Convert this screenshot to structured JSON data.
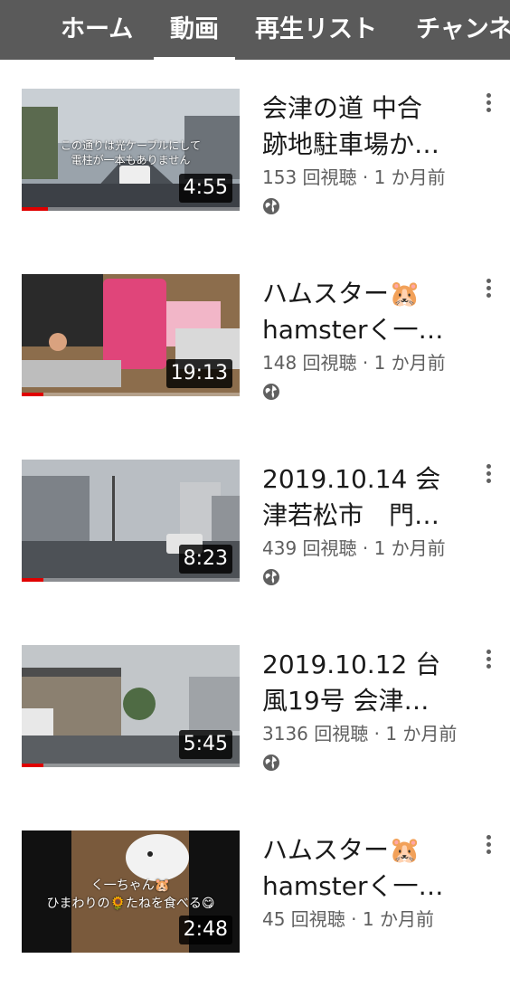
{
  "tabs": [
    {
      "label": "ホーム",
      "active": false
    },
    {
      "label": "動画",
      "active": true
    },
    {
      "label": "再生リスト",
      "active": false
    },
    {
      "label": "チャンネ",
      "active": false
    }
  ],
  "videos": [
    {
      "title": "会津の道 中合\n跡地駐車場か…",
      "meta": "153 回視聴 · 1 か月前",
      "duration": "4:55",
      "watched_fraction": 0.12,
      "thumb_caption_1": "この通りは光ケーブルにして",
      "thumb_caption_2": "電柱が一本もありません"
    },
    {
      "title": "ハムスター🐹\nhamsterく一…",
      "meta": "148 回視聴 · 1 か月前",
      "duration": "19:13",
      "watched_fraction": 0.1
    },
    {
      "title": "2019.10.14 会\n津若松市　門…",
      "meta": "439 回視聴 · 1 か月前",
      "duration": "8:23",
      "watched_fraction": 0.1
    },
    {
      "title": "2019.10.12 台\n風19号 会津…",
      "meta": "3136 回視聴 · 1 か月前",
      "duration": "5:45",
      "watched_fraction": 0.1
    },
    {
      "title": "ハムスター🐹\nhamsterく一…",
      "meta": "45 回視聴 · 1 か月前",
      "duration": "2:48",
      "watched_fraction": 0,
      "thumb_caption_1": "く一ちゃん🐹",
      "thumb_caption_2": "ひまわりの🌻たねを食べる😋"
    }
  ],
  "colors": {
    "tabbar": "#5a5a5a",
    "progress": "#e00000"
  },
  "icons": {
    "globe": "globe-icon",
    "more": "more-vert-icon"
  }
}
